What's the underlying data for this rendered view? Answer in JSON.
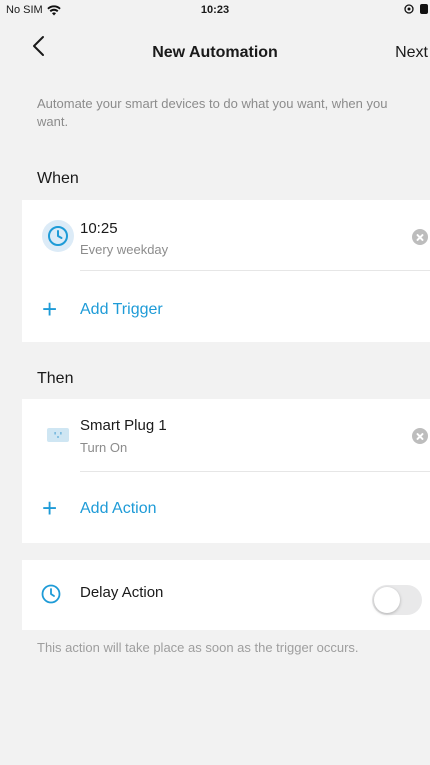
{
  "status_bar": {
    "carrier": "No SIM",
    "time": "10:23"
  },
  "nav": {
    "title": "New Automation",
    "next_label": "Next"
  },
  "intro_text": "Automate your smart devices to do what you want, when you want.",
  "when": {
    "header": "When",
    "trigger": {
      "title": "10:25",
      "subtitle": "Every weekday",
      "icon": "clock-icon"
    },
    "add_label": "Add Trigger"
  },
  "then": {
    "header": "Then",
    "action": {
      "title": "Smart Plug 1",
      "subtitle": "Turn On",
      "icon": "smart-plug-icon"
    },
    "add_label": "Add Action"
  },
  "delay": {
    "label": "Delay Action",
    "enabled": false,
    "icon": "clock-icon"
  },
  "footer_note": "This action will take place as soon as the trigger occurs.",
  "colors": {
    "accent": "#1e9bd7",
    "background": "#f2f2f2",
    "card": "#ffffff",
    "muted_text": "#8c8c8c"
  }
}
